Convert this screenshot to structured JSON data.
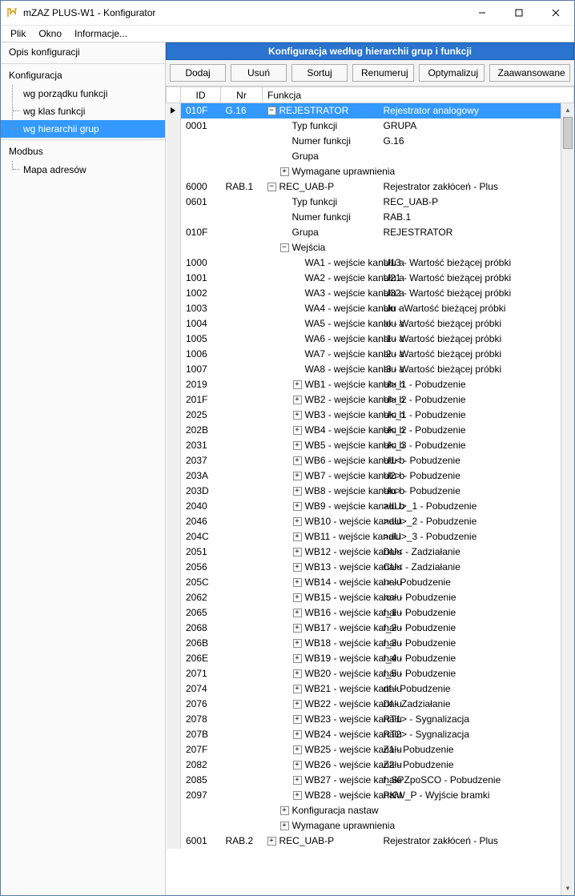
{
  "window": {
    "title": "mZAZ PLUS-W1 - Konfigurator"
  },
  "menu": {
    "plik": "Plik",
    "okno": "Okno",
    "informacje": "Informacje..."
  },
  "sidebar": {
    "opis": "Opis konfiguracji",
    "konfiguracja": "Konfiguracja",
    "wg_porzadku": "wg porządku funkcji",
    "wg_klas": "wg klas funkcji",
    "wg_hierarchii": "wg hierarchii grup",
    "modbus": "Modbus",
    "mapa_adresow": "Mapa adresów"
  },
  "main": {
    "heading": "Konfiguracja według hierarchii grup i funkcji",
    "buttons": {
      "dodaj": "Dodaj",
      "usun": "Usuń",
      "sortuj": "Sortuj",
      "renumeruj": "Renumeruj",
      "optymalizuj": "Optymalizuj",
      "zaawansowane": "Zaawansowane"
    },
    "columns": {
      "id": "ID",
      "nr": "Nr",
      "funkcja": "Funkcja"
    }
  },
  "rows": [
    {
      "id": "010F",
      "nr": "G.16",
      "exp": "-",
      "indent": 0,
      "label": "REJESTRATOR",
      "value": "Rejestrator analogowy",
      "selected": true
    },
    {
      "id": "0001",
      "nr": "",
      "exp": "",
      "indent": 1,
      "label": "Typ funkcji",
      "value": "GRUPA"
    },
    {
      "id": "",
      "nr": "",
      "exp": "",
      "indent": 1,
      "label": "Numer funkcji",
      "value": "G.16"
    },
    {
      "id": "",
      "nr": "",
      "exp": "",
      "indent": 1,
      "label": "Grupa",
      "value": ""
    },
    {
      "id": "",
      "nr": "",
      "exp": "+",
      "indent": 1,
      "label": "Wymagane uprawnienia",
      "value": ""
    },
    {
      "id": "6000",
      "nr": "RAB.1",
      "exp": "-",
      "indent": 0,
      "label": "REC_UAB-P",
      "value": "Rejestrator zakłóceń - Plus"
    },
    {
      "id": "0601",
      "nr": "",
      "exp": "",
      "indent": 1,
      "label": "Typ funkcji",
      "value": "REC_UAB-P"
    },
    {
      "id": "",
      "nr": "",
      "exp": "",
      "indent": 1,
      "label": "Numer funkcji",
      "value": "RAB.1"
    },
    {
      "id": "010F",
      "nr": "",
      "exp": "",
      "indent": 1,
      "label": "Grupa",
      "value": "REJESTRATOR"
    },
    {
      "id": "",
      "nr": "",
      "exp": "-",
      "indent": 1,
      "label": "Wejścia",
      "value": ""
    },
    {
      "id": "1000",
      "nr": "",
      "exp": "",
      "indent": 2,
      "label": "WA1 - wejście kanału a",
      "value": "U13 - Wartość bieżącej próbki"
    },
    {
      "id": "1001",
      "nr": "",
      "exp": "",
      "indent": 2,
      "label": "WA2 - wejście kanału a",
      "value": "U21 - Wartość bieżącej próbki"
    },
    {
      "id": "1002",
      "nr": "",
      "exp": "",
      "indent": 2,
      "label": "WA3 - wejście kanału a",
      "value": "U32 - Wartość bieżącej próbki"
    },
    {
      "id": "1003",
      "nr": "",
      "exp": "",
      "indent": 2,
      "label": "WA4 - wejście kanału a",
      "value": "Uo - Wartość bieżącej próbki"
    },
    {
      "id": "1004",
      "nr": "",
      "exp": "",
      "indent": 2,
      "label": "WA5 - wejście kanału a",
      "value": "Io - Wartość bieżącej próbki"
    },
    {
      "id": "1005",
      "nr": "",
      "exp": "",
      "indent": 2,
      "label": "WA6 - wejście kanału a",
      "value": "I1 - Wartość bieżącej próbki"
    },
    {
      "id": "1006",
      "nr": "",
      "exp": "",
      "indent": 2,
      "label": "WA7 - wejście kanału a",
      "value": "I2 - Wartość bieżącej próbki"
    },
    {
      "id": "1007",
      "nr": "",
      "exp": "",
      "indent": 2,
      "label": "WA8 - wejście kanału a",
      "value": "I3 - Wartość bieżącej próbki"
    },
    {
      "id": "2019",
      "nr": "",
      "exp": "+",
      "indent": 2,
      "label": "WB1 - wejście kanału b",
      "value": "U>_1 - Pobudzenie"
    },
    {
      "id": "201F",
      "nr": "",
      "exp": "+",
      "indent": 2,
      "label": "WB2 - wejście kanału b",
      "value": "U>_2 - Pobudzenie"
    },
    {
      "id": "2025",
      "nr": "",
      "exp": "+",
      "indent": 2,
      "label": "WB3 - wejście kanału b",
      "value": "U<_1 - Pobudzenie"
    },
    {
      "id": "202B",
      "nr": "",
      "exp": "+",
      "indent": 2,
      "label": "WB4 - wejście kanału b",
      "value": "U<_2 - Pobudzenie"
    },
    {
      "id": "2031",
      "nr": "",
      "exp": "+",
      "indent": 2,
      "label": "WB5 - wejście kanału b",
      "value": "U<_3 - Pobudzenie"
    },
    {
      "id": "2037",
      "nr": "",
      "exp": "+",
      "indent": 2,
      "label": "WB6 - wejście kanału b",
      "value": "U1< - Pobudzenie"
    },
    {
      "id": "203A",
      "nr": "",
      "exp": "+",
      "indent": 2,
      "label": "WB7 - wejście kanału b",
      "value": "U2> - Pobudzenie"
    },
    {
      "id": "203D",
      "nr": "",
      "exp": "+",
      "indent": 2,
      "label": "WB8 - wejście kanału b",
      "value": "Uo> - Pobudzenie"
    },
    {
      "id": "2040",
      "nr": "",
      "exp": "+",
      "indent": 2,
      "label": "WB9 - wejście kanału b",
      "value": ">dU>_1 - Pobudzenie"
    },
    {
      "id": "2046",
      "nr": "",
      "exp": "+",
      "indent": 2,
      "label": "WB10 - wejście kanału",
      "value": ">dU>_2 - Pobudzenie"
    },
    {
      "id": "204C",
      "nr": "",
      "exp": "+",
      "indent": 2,
      "label": "WB11 - wejście kanału",
      "value": ">dU>_3 - Pobudzenie"
    },
    {
      "id": "2051",
      "nr": "",
      "exp": "+",
      "indent": 2,
      "label": "WB12 - wejście kanału",
      "value": "DU< - Zadziałanie"
    },
    {
      "id": "2056",
      "nr": "",
      "exp": "+",
      "indent": 2,
      "label": "WB13 - wejście kanału",
      "value": "CU< - Zadziałanie"
    },
    {
      "id": "205C",
      "nr": "",
      "exp": "+",
      "indent": 2,
      "label": "WB14 - wejście kanału",
      "value": "I> - Pobudzenie"
    },
    {
      "id": "2062",
      "nr": "",
      "exp": "+",
      "indent": 2,
      "label": "WB15 - wejście kanału",
      "value": "Io> - Pobudzenie"
    },
    {
      "id": "2065",
      "nr": "",
      "exp": "+",
      "indent": 2,
      "label": "WB16 - wejście kanału",
      "value": "f_1 - Pobudzenie"
    },
    {
      "id": "2068",
      "nr": "",
      "exp": "+",
      "indent": 2,
      "label": "WB17 - wejście kanału",
      "value": "f_2 - Pobudzenie"
    },
    {
      "id": "206B",
      "nr": "",
      "exp": "+",
      "indent": 2,
      "label": "WB18 - wejście kanału",
      "value": "f_3 - Pobudzenie"
    },
    {
      "id": "206E",
      "nr": "",
      "exp": "+",
      "indent": 2,
      "label": "WB19 - wejście kanału",
      "value": "f_4 - Pobudzenie"
    },
    {
      "id": "2071",
      "nr": "",
      "exp": "+",
      "indent": 2,
      "label": "WB20 - wejście kanału",
      "value": "f_5 - Pobudzenie"
    },
    {
      "id": "2074",
      "nr": "",
      "exp": "+",
      "indent": 2,
      "label": "WB21 - wejście kanału",
      "value": "df - Pobudzenie"
    },
    {
      "id": "2076",
      "nr": "",
      "exp": "+",
      "indent": 2,
      "label": "WB22 - wejście kanału",
      "value": "Df - Zadziałanie"
    },
    {
      "id": "2078",
      "nr": "",
      "exp": "+",
      "indent": 2,
      "label": "WB23 - wejście kanału",
      "value": "RT1> - Sygnalizacja"
    },
    {
      "id": "207B",
      "nr": "",
      "exp": "+",
      "indent": 2,
      "label": "WB24 - wejście kanału",
      "value": "RT2> - Sygnalizacja"
    },
    {
      "id": "207F",
      "nr": "",
      "exp": "+",
      "indent": 2,
      "label": "WB25 - wejście kanału",
      "value": "Z1 - Pobudzenie"
    },
    {
      "id": "2082",
      "nr": "",
      "exp": "+",
      "indent": 2,
      "label": "WB26 - wejście kanału",
      "value": "Z2 - Pobudzenie"
    },
    {
      "id": "2085",
      "nr": "",
      "exp": "+",
      "indent": 2,
      "label": "WB27 - wejście kanału",
      "value": "f_SPZpoSCO - Pobudzenie"
    },
    {
      "id": "2097",
      "nr": "",
      "exp": "+",
      "indent": 2,
      "label": "WB28 - wejście kanału",
      "value": "PKW_P - Wyjście bramki"
    },
    {
      "id": "",
      "nr": "",
      "exp": "+",
      "indent": 1,
      "label": "Konfiguracja nastaw",
      "value": ""
    },
    {
      "id": "",
      "nr": "",
      "exp": "+",
      "indent": 1,
      "label": "Wymagane uprawnienia",
      "value": ""
    },
    {
      "id": "6001",
      "nr": "RAB.2",
      "exp": "+",
      "indent": 0,
      "label": "REC_UAB-P",
      "value": "Rejestrator zakłóceń - Plus"
    }
  ]
}
